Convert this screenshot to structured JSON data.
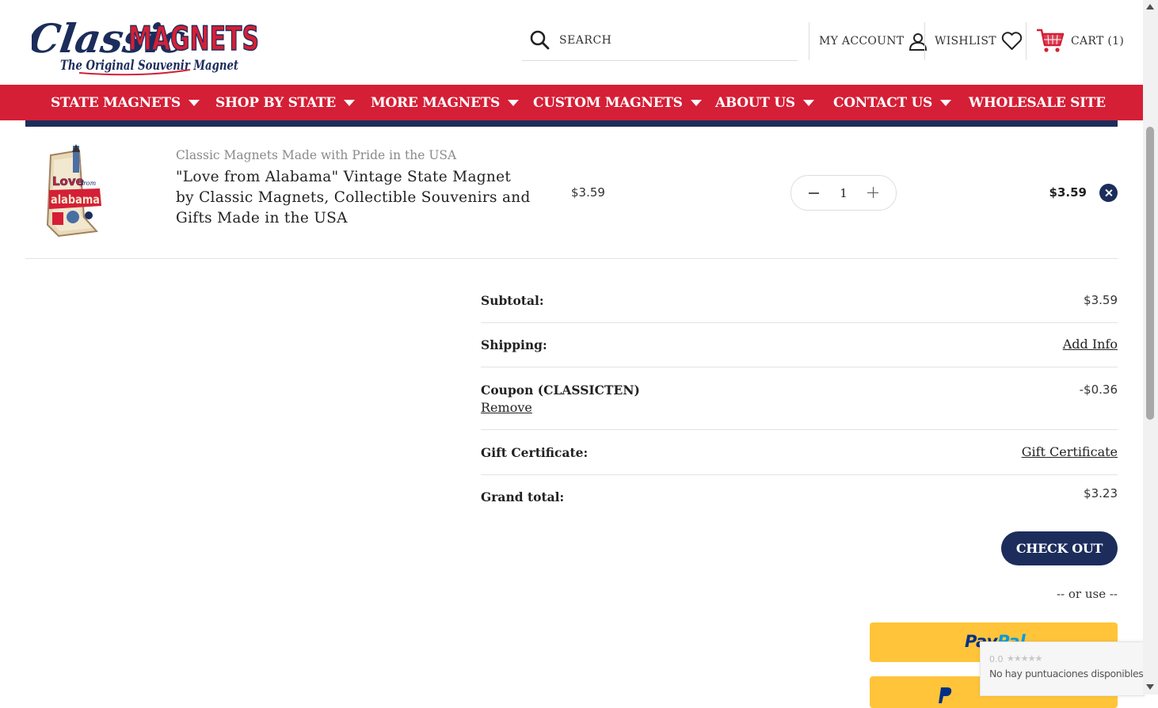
{
  "header": {
    "logo_primary": "Classic",
    "logo_secondary": "MAGNETS",
    "logo_tagline": "The Original Souvenir Magnet",
    "search_label": "SEARCH",
    "account_label": "MY ACCOUNT",
    "wishlist_label": "WISHLIST",
    "cart_label": "CART (1)",
    "accent_color": "#d51f36",
    "navy_color": "#1c2d5c"
  },
  "nav": {
    "items": [
      {
        "label": "STATE MAGNETS",
        "has_dropdown": true
      },
      {
        "label": "SHOP BY STATE",
        "has_dropdown": true
      },
      {
        "label": "MORE MAGNETS",
        "has_dropdown": true
      },
      {
        "label": "CUSTOM MAGNETS",
        "has_dropdown": true
      },
      {
        "label": "ABOUT US",
        "has_dropdown": true
      },
      {
        "label": "CONTACT US",
        "has_dropdown": true
      },
      {
        "label": "WHOLESALE SITE",
        "has_dropdown": false
      }
    ]
  },
  "cart": {
    "items": [
      {
        "brand": "Classic Magnets Made with Pride in the USA",
        "title": "\"Love from Alabama\" Vintage State Magnet by Classic Magnets, Collectible Souvenirs and Gifts Made in the USA",
        "price": "$3.59",
        "quantity": "1",
        "line_total": "$3.59",
        "image_text_1": "Love",
        "image_text_2": "from",
        "image_text_3": "alabama"
      }
    ]
  },
  "totals": {
    "subtotal_label": "Subtotal:",
    "subtotal_value": "$3.59",
    "shipping_label": "Shipping:",
    "shipping_link": "Add Info",
    "coupon_label": "Coupon (CLASSICTEN)",
    "coupon_remove": "Remove",
    "coupon_value": "-$0.36",
    "gift_label": "Gift Certificate:",
    "gift_link": "Gift Certificate",
    "grand_label": "Grand total:",
    "grand_value": "$3.23"
  },
  "checkout": {
    "button_label": "CHECK OUT",
    "or_use": "-- or use --",
    "paypal_label": "PayPal"
  },
  "rating_widget": {
    "score": "0.0",
    "stars": "★★★★★",
    "text": "No hay puntuaciones disponibles"
  }
}
